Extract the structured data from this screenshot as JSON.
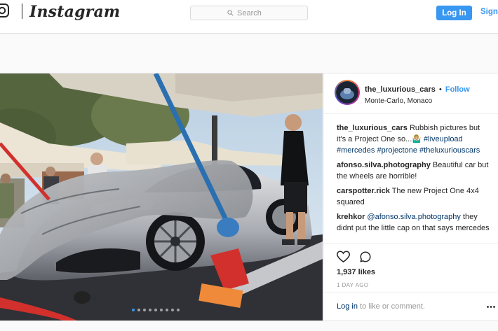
{
  "nav": {
    "brand": "Instagram",
    "search_placeholder": "Search",
    "login_label": "Log In",
    "signup_label": "Sign"
  },
  "post": {
    "author": "the_luxurious_cars",
    "separator": "•",
    "follow_label": "Follow",
    "location": "Monte-Carlo, Monaco",
    "carousel_dots": 9,
    "carousel_active_index": 0,
    "caption": {
      "user": "the_luxurious_cars",
      "text": "Rubbish pictures but it's a Project One so...🤷🏼‍♂️",
      "hashtags": [
        "#liveupload",
        "#mercedes",
        "#projectone",
        "#theluxuriouscars"
      ]
    },
    "comments": [
      {
        "user": "afonso.silva.photography",
        "text": "Beautiful car but the wheels are horrible!"
      },
      {
        "user": "carspotter.rick",
        "text": "The new Project One 4x4 squared"
      },
      {
        "user": "krehkor",
        "mention": "@afonso.silva.photography",
        "text": "they didnt put the little cap on that says mercedes once they are applied the wheels"
      }
    ],
    "likes": "1,937 likes",
    "time_ago": "1 DAY AGO",
    "login_prompt": {
      "link": "Log in",
      "rest": "to like or comment."
    },
    "icons": {
      "like": "heart-icon",
      "comment": "comment-icon",
      "more": "more-options-icon"
    }
  },
  "colors": {
    "accent": "#3897f0",
    "link": "#003569",
    "muted": "#999999"
  }
}
